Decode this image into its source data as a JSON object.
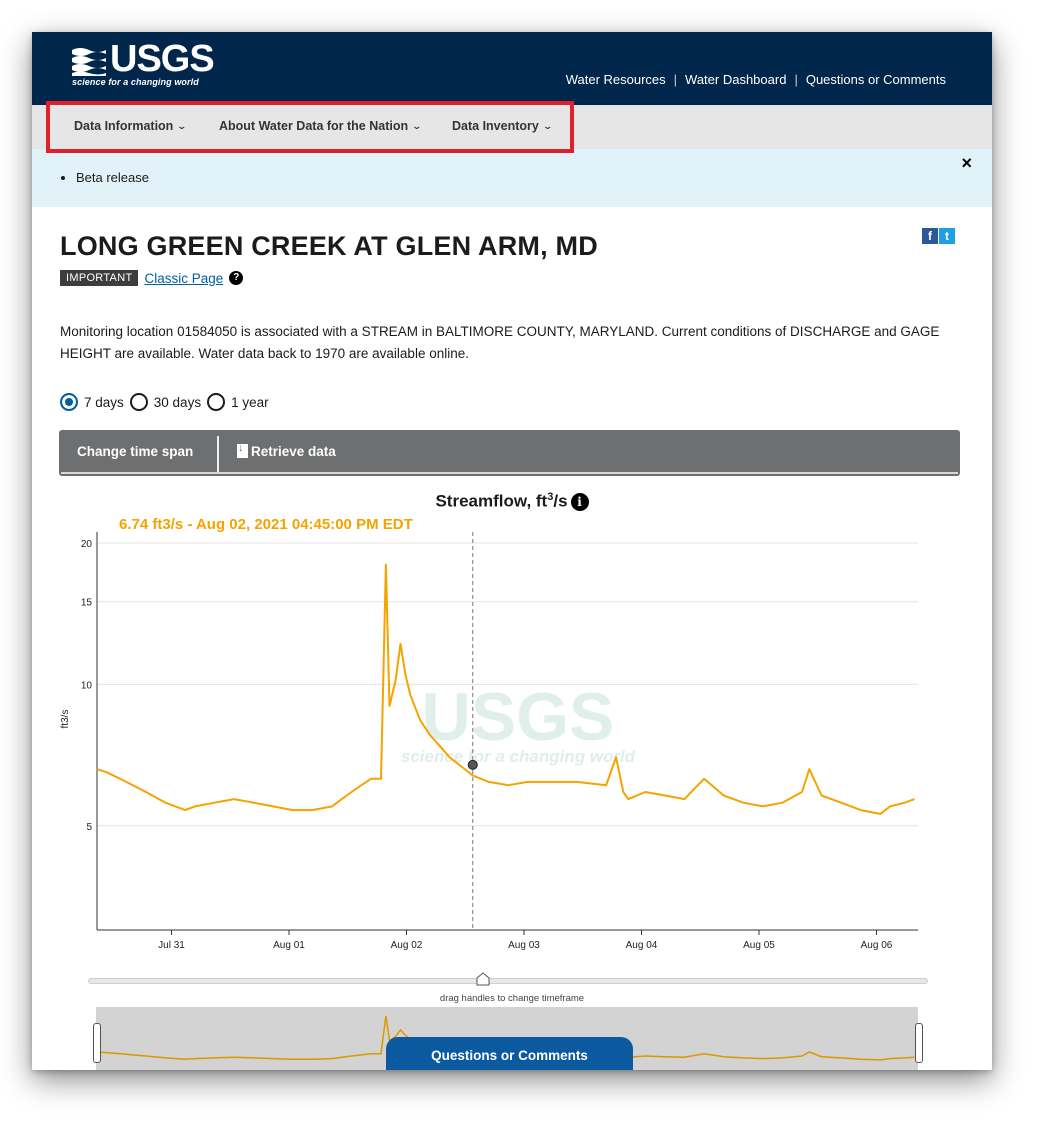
{
  "header": {
    "logo_text": "USGS",
    "logo_tagline": "science for a changing world",
    "links": [
      "Water Resources",
      "Water Dashboard",
      "Questions or Comments"
    ]
  },
  "nav": {
    "items": [
      "Data Information",
      "About Water Data for the Nation",
      "Data Inventory"
    ]
  },
  "banner": {
    "items": [
      "Beta release"
    ],
    "close_label": "×"
  },
  "site": {
    "title": "LONG GREEN CREEK AT GLEN ARM, MD",
    "badge": "IMPORTANT",
    "classic_link": "Classic Page",
    "help_icon": "?",
    "social_fb": "f",
    "social_tw": "t",
    "description": "Monitoring location 01584050 is associated with a STREAM in BALTIMORE COUNTY, MARYLAND. Current conditions of DISCHARGE and GAGE HEIGHT are available. Water data back to 1970 are available online."
  },
  "time_span": {
    "options": [
      "7 days",
      "30 days",
      "1 year"
    ],
    "selected": "7 days"
  },
  "toolbar": {
    "change": "Change time span",
    "retrieve": "Retrieve data"
  },
  "chart_data": {
    "type": "line",
    "title_main": "Streamflow, ft",
    "title_sup": "3",
    "title_tail": "/s",
    "info_icon": "i",
    "tooltip": "6.74 ft3/s - Aug 02, 2021 04:45:00 PM EDT",
    "ylabel": "ft3/s",
    "yscale": "log",
    "yticks": [
      5,
      10,
      15,
      20
    ],
    "xticks": [
      "Jul 31",
      "Aug 01",
      "Aug 02",
      "Aug 03",
      "Aug 04",
      "Aug 05",
      "Aug 06"
    ],
    "watermark": "USGS",
    "watermark_tagline": "science for a changing world",
    "line_color": "#f5a300",
    "series": [
      {
        "x": [
          "2021-07-30 12:00",
          "2021-07-30 14:00",
          "2021-07-30 18:00",
          "2021-07-30 22:00",
          "2021-07-31 02:00",
          "2021-07-31 06:00",
          "2021-07-31 08:00",
          "2021-07-31 12:00",
          "2021-07-31 16:00",
          "2021-07-31 20:00",
          "2021-08-01 00:00",
          "2021-08-01 04:00",
          "2021-08-01 08:00",
          "2021-08-01 12:00",
          "2021-08-01 14:00",
          "2021-08-01 16:00",
          "2021-08-01 18:00",
          "2021-08-01 20:00",
          "2021-08-01 22:00",
          "2021-08-01 23:00",
          "2021-08-01 23:45",
          "2021-08-02 01:00",
          "2021-08-02 02:00",
          "2021-08-02 03:00",
          "2021-08-02 04:00",
          "2021-08-02 06:00",
          "2021-08-02 08:00",
          "2021-08-02 10:00",
          "2021-08-02 12:00",
          "2021-08-02 14:00",
          "2021-08-02 16:45",
          "2021-08-02 20:00",
          "2021-08-03 00:00",
          "2021-08-03 04:00",
          "2021-08-03 08:00",
          "2021-08-03 14:00",
          "2021-08-03 20:00",
          "2021-08-03 22:00",
          "2021-08-03 23:30",
          "2021-08-04 00:30",
          "2021-08-04 04:00",
          "2021-08-04 08:00",
          "2021-08-04 12:00",
          "2021-08-04 16:00",
          "2021-08-04 20:00",
          "2021-08-05 00:00",
          "2021-08-05 04:00",
          "2021-08-05 08:00",
          "2021-08-05 12:00",
          "2021-08-05 13:30",
          "2021-08-05 16:00",
          "2021-08-05 20:00",
          "2021-08-06 00:00",
          "2021-08-06 04:00",
          "2021-08-06 06:00",
          "2021-08-06 09:00",
          "2021-08-06 11:00"
        ],
        "y": [
          6.6,
          6.5,
          6.2,
          5.9,
          5.6,
          5.4,
          5.5,
          5.6,
          5.7,
          5.6,
          5.5,
          5.4,
          5.4,
          5.5,
          5.7,
          5.9,
          6.1,
          6.3,
          6.3,
          18.0,
          9.0,
          10.2,
          12.2,
          10.5,
          9.5,
          8.4,
          7.8,
          7.4,
          7.0,
          6.74,
          6.4,
          6.2,
          6.1,
          6.2,
          6.2,
          6.2,
          6.1,
          7.0,
          5.9,
          5.7,
          5.9,
          5.8,
          5.7,
          6.3,
          5.8,
          5.6,
          5.5,
          5.6,
          5.9,
          6.6,
          5.8,
          5.6,
          5.4,
          5.3,
          5.5,
          5.6,
          5.7
        ]
      }
    ]
  },
  "chart_ui": {
    "drag_hint": "drag handles to change timeframe"
  },
  "footer": {
    "questions_button": "Questions or Comments"
  }
}
